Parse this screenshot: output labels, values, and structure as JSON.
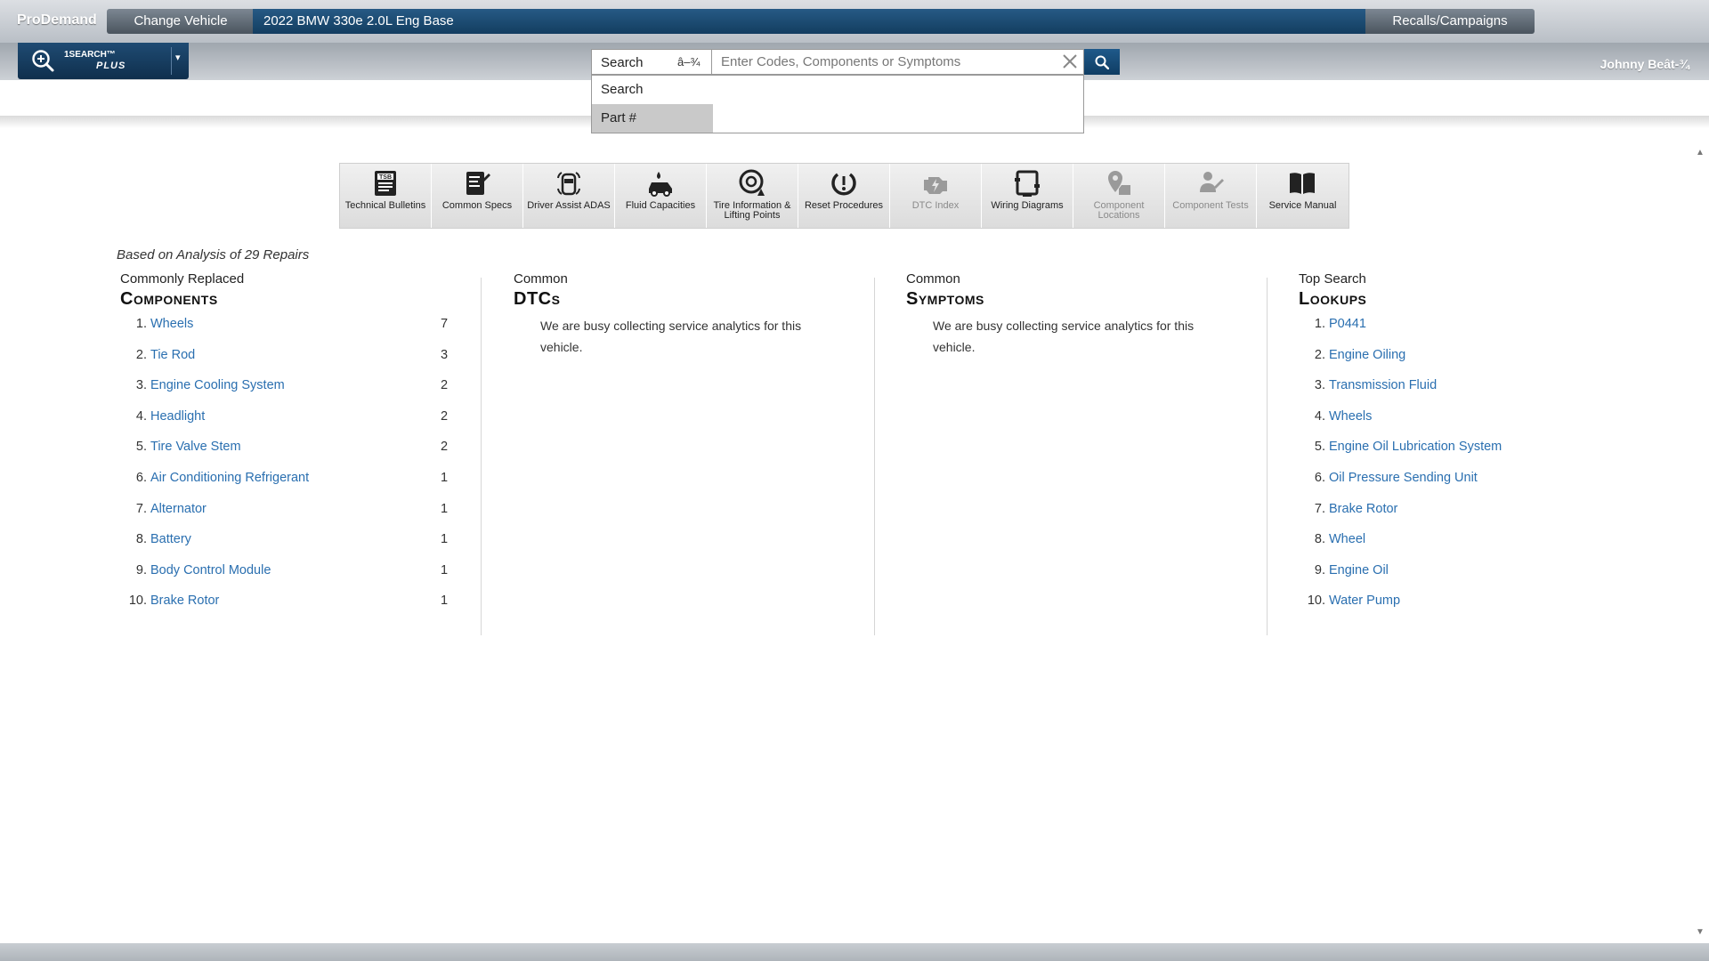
{
  "topbar": {
    "brand": "ProDemand",
    "change_vehicle": "Change Vehicle",
    "vehicle": "2022 BMW 330e 2.0L Eng Base",
    "recalls": "Recalls/Campaigns"
  },
  "onesearch": {
    "line1": "1SEARCH™",
    "line2": "PLUS",
    "icon": "zoom-in-icon"
  },
  "user": {
    "name": "Johnny Beât-¾"
  },
  "search": {
    "mode": "Search",
    "mode_arrow": "â–¾",
    "placeholder": "Enter Codes, Components or Symptoms",
    "value": "",
    "dropdown_options": [
      "Search",
      "Part #"
    ],
    "highlighted_option": "Part #"
  },
  "toolbar": [
    {
      "label": "Technical Bulletins",
      "icon": "tsb-icon",
      "enabled": true
    },
    {
      "label": "Common Specs",
      "icon": "specs-icon",
      "enabled": true
    },
    {
      "label": "Driver Assist ADAS",
      "icon": "adas-car-icon",
      "enabled": true
    },
    {
      "label": "Fluid Capacities",
      "icon": "fluid-car-icon",
      "enabled": true
    },
    {
      "label": "Tire Information & Lifting Points",
      "icon": "tire-icon",
      "enabled": true
    },
    {
      "label": "Reset Procedures",
      "icon": "reset-icon",
      "enabled": true
    },
    {
      "label": "DTC Index",
      "icon": "engine-icon",
      "enabled": false
    },
    {
      "label": "Wiring Diagrams",
      "icon": "wiring-icon",
      "enabled": true
    },
    {
      "label": "Component Locations",
      "icon": "location-pin-icon",
      "enabled": false
    },
    {
      "label": "Component Tests",
      "icon": "component-test-icon",
      "enabled": false
    },
    {
      "label": "Service Manual",
      "icon": "book-icon",
      "enabled": true
    }
  ],
  "analysis": {
    "note": "Based on Analysis of 29 Repairs"
  },
  "components": {
    "pre": "Commonly Replaced",
    "title": "Components",
    "items": [
      {
        "num": "1.",
        "name": "Wheels",
        "count": "7"
      },
      {
        "num": "2.",
        "name": "Tie Rod",
        "count": "3"
      },
      {
        "num": "3.",
        "name": "Engine Cooling System",
        "count": "2"
      },
      {
        "num": "4.",
        "name": "Headlight",
        "count": "2"
      },
      {
        "num": "5.",
        "name": "Tire Valve Stem",
        "count": "2"
      },
      {
        "num": "6.",
        "name": "Air Conditioning Refrigerant",
        "count": "1"
      },
      {
        "num": "7.",
        "name": "Alternator",
        "count": "1"
      },
      {
        "num": "8.",
        "name": "Battery",
        "count": "1"
      },
      {
        "num": "9.",
        "name": "Body Control Module",
        "count": "1"
      },
      {
        "num": "10.",
        "name": "Brake Rotor",
        "count": "1"
      }
    ]
  },
  "dtcs": {
    "pre": "Common",
    "title": "DTCs",
    "message": "We are busy collecting service analytics for this vehicle."
  },
  "symptoms": {
    "pre": "Common",
    "title": "Symptoms",
    "message": "We are busy collecting service analytics for this vehicle."
  },
  "lookups": {
    "pre": "Top Search",
    "title": "Lookups",
    "items": [
      {
        "num": "1.",
        "name": "P0441"
      },
      {
        "num": "2.",
        "name": "Engine Oiling"
      },
      {
        "num": "3.",
        "name": "Transmission Fluid"
      },
      {
        "num": "4.",
        "name": "Wheels"
      },
      {
        "num": "5.",
        "name": "Engine Oil Lubrication System"
      },
      {
        "num": "6.",
        "name": "Oil Pressure Sending Unit"
      },
      {
        "num": "7.",
        "name": "Brake Rotor"
      },
      {
        "num": "8.",
        "name": "Wheel"
      },
      {
        "num": "9.",
        "name": "Engine Oil"
      },
      {
        "num": "10.",
        "name": "Water Pump"
      }
    ]
  },
  "colors": {
    "link": "#2a6fb0",
    "vehicle_bar": "#1c4b72",
    "disabled_tool": "#8a8a8a"
  }
}
